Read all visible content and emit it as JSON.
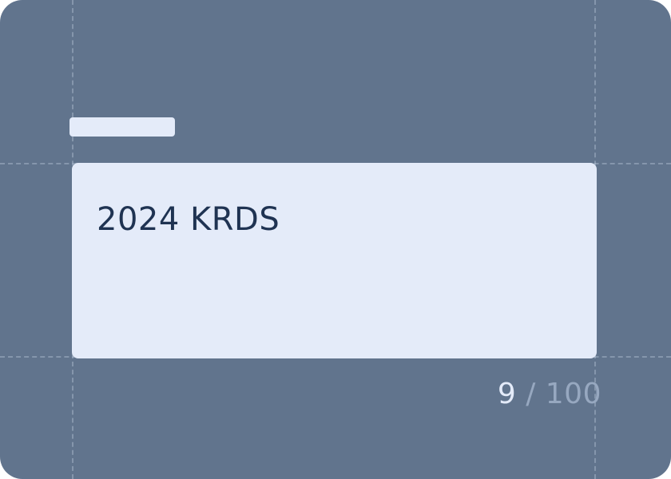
{
  "colors": {
    "background": "#61748d",
    "field_fill": "#e4ebf9",
    "field_text": "#1f3352",
    "label_placeholder": "#e4ebf9",
    "counter_current": "#e4ebf9",
    "counter_max": "#97a8c0"
  },
  "textarea": {
    "value": "2024 KRDS"
  },
  "counter": {
    "current": "9",
    "separator": " / ",
    "max": "100"
  }
}
